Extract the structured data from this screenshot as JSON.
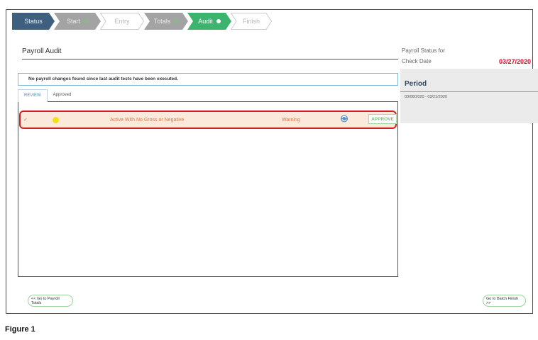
{
  "steps": [
    {
      "label": "Status",
      "state": "dark"
    },
    {
      "label": "Start",
      "state": "grey"
    },
    {
      "label": "Entry",
      "state": "outline"
    },
    {
      "label": "Totals",
      "state": "grey"
    },
    {
      "label": "Audit",
      "state": "green"
    },
    {
      "label": "Finish",
      "state": "outline"
    }
  ],
  "main": {
    "title": "Payroll Audit",
    "notice": "No payroll changes found since last audit tests have been executed.",
    "tabs": [
      {
        "label": "REVIEW"
      },
      {
        "label": "Approved"
      }
    ],
    "row": {
      "check": "✔",
      "description": "Active With No Gross or Negative",
      "level": "Warning",
      "approve_label": "APPROVE"
    }
  },
  "right_panel": {
    "status_for_label": "Payroll Status for",
    "check_date_label": "Check Date",
    "check_date": "03/27/2020",
    "period_heading": "Period",
    "period_range": "03/08/2020 - 03/21/2020"
  },
  "buttons": {
    "prev_label": "<< Go to Payroll Totals",
    "next_label": "Go to Batch Finish >>"
  },
  "caption": "Figure 1",
  "colors": {
    "step_dark": "#3f5f7f",
    "step_grey": "#a3a3a3",
    "step_green": "#3cb46e",
    "accent_blue": "#3a8fc4",
    "highlight_red": "#d42020",
    "date_red": "#c8102e",
    "warning_orange": "#e07a4a"
  },
  "icons": {
    "refresh": "refresh-icon",
    "check": "check-icon"
  }
}
